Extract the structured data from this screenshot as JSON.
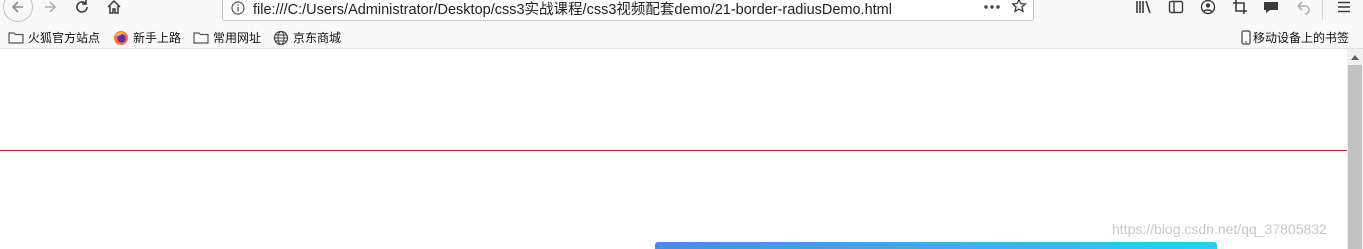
{
  "address_bar": {
    "url": "file:///C:/Users/Administrator/Desktop/css3实战课程/css3视频配套demo/21-border-radiusDemo.html"
  },
  "bookmarks": [
    {
      "label": "火狐官方站点",
      "icon": "folder-icon"
    },
    {
      "label": "新手上路",
      "icon": "firefox-icon"
    },
    {
      "label": "常用网址",
      "icon": "folder-icon"
    },
    {
      "label": "京东商城",
      "icon": "globe-icon"
    }
  ],
  "mobile_bookmarks": {
    "label": "移动设备上的书签",
    "icon": "mobile-icon"
  },
  "watermark": "https://blog.csdn.net/qq_37805832",
  "colors": {
    "divider_line": "#cc1a1a",
    "gradient_start": "#4a8af4",
    "gradient_end": "#22d3f0"
  }
}
